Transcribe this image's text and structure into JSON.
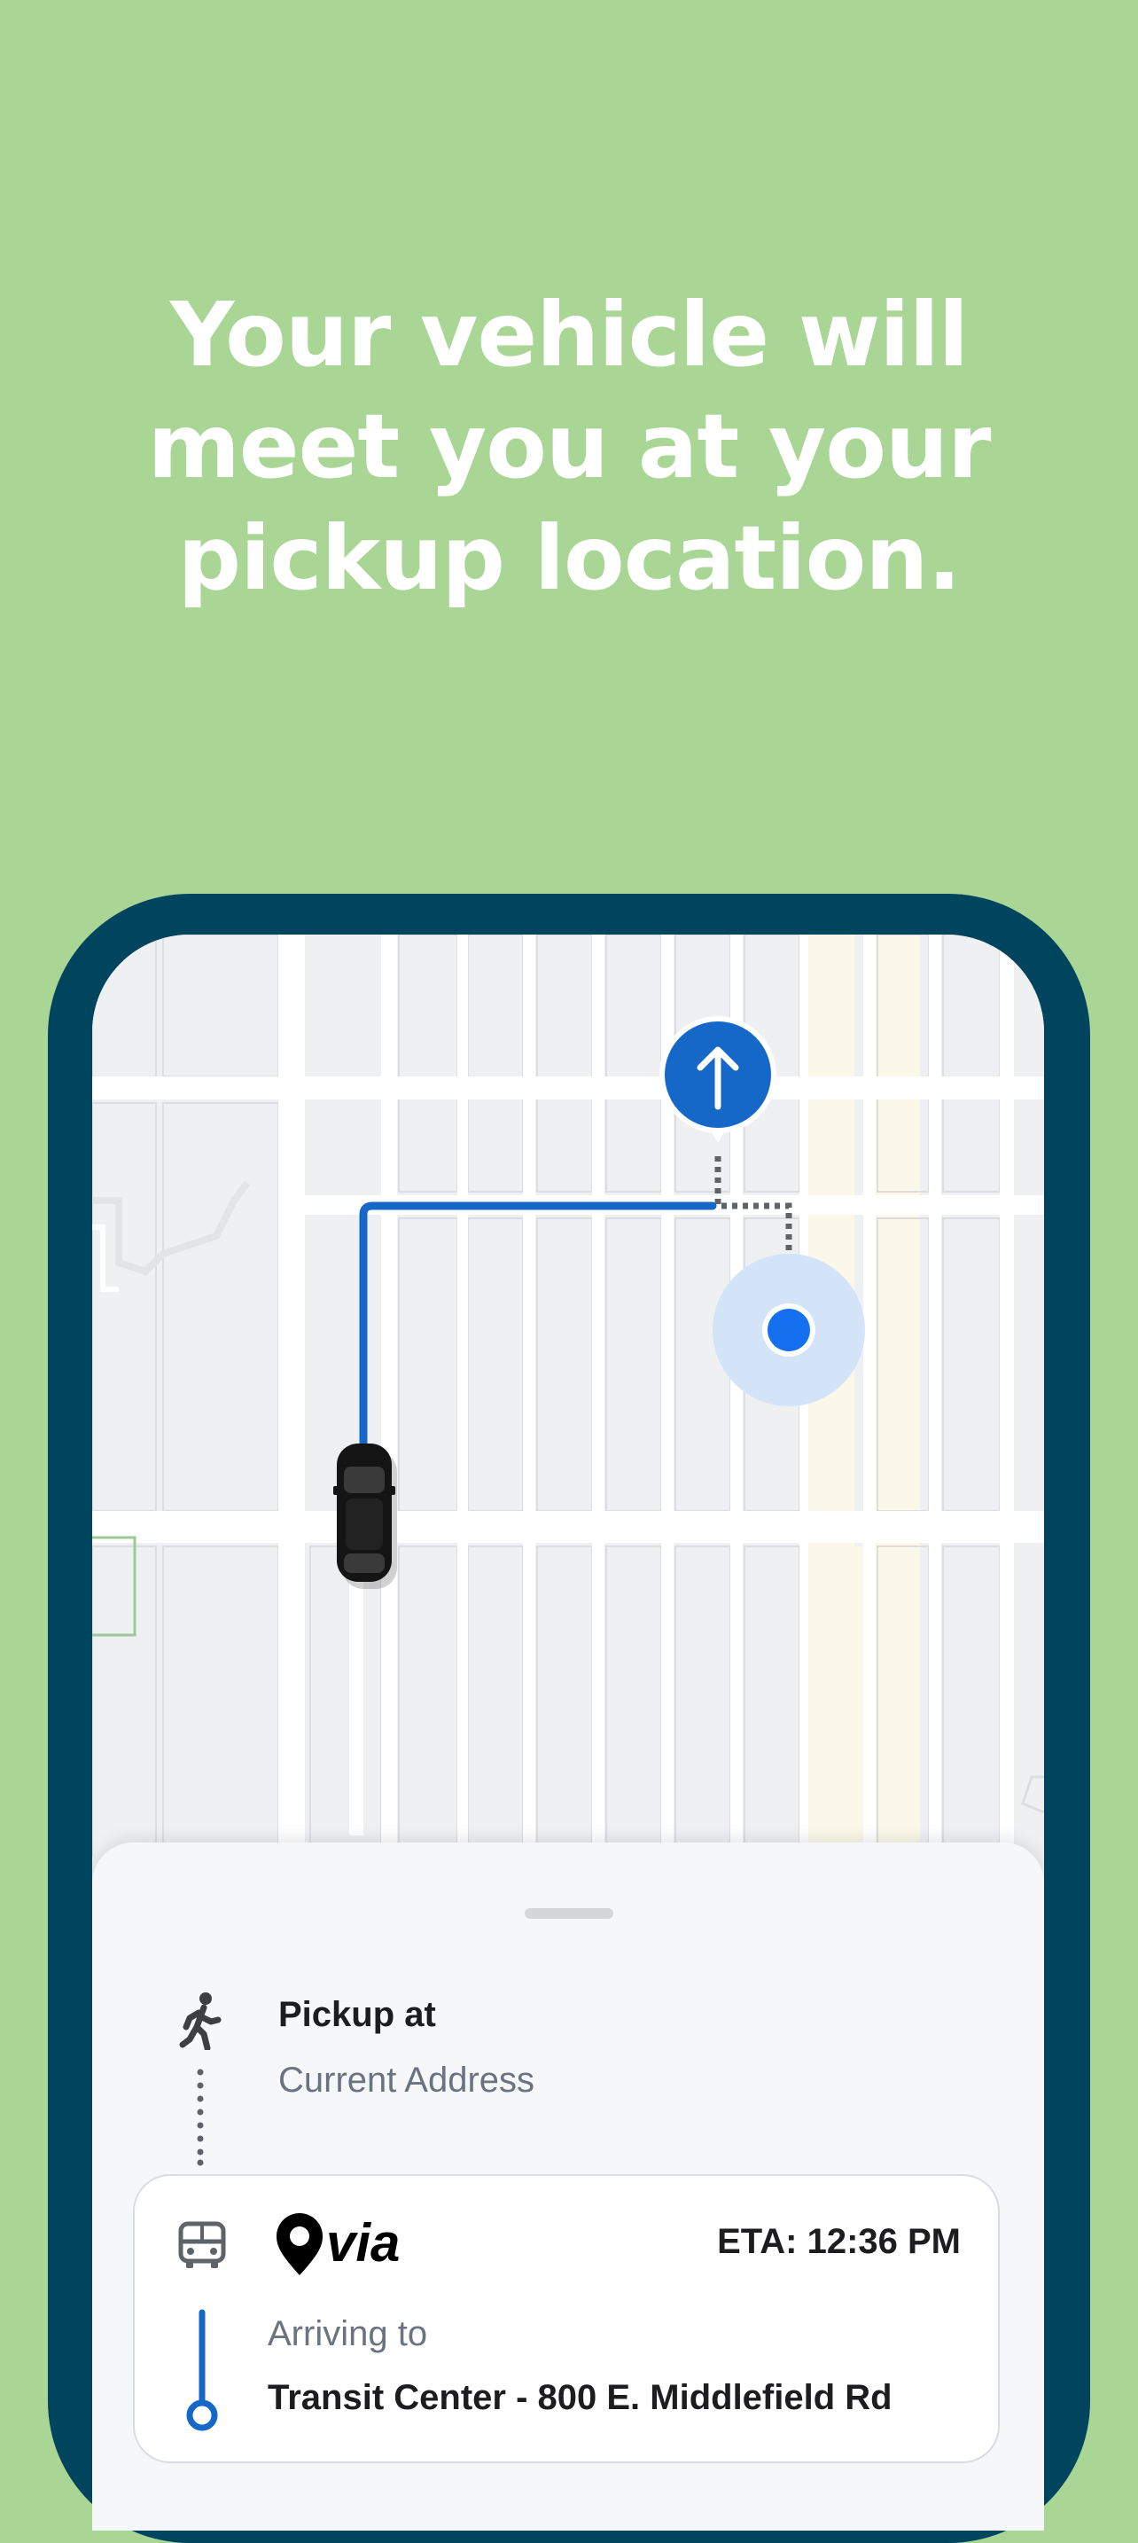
{
  "headline": {
    "line1": "Your vehicle will",
    "line2": "meet you at your",
    "line3": "pickup location."
  },
  "map": {
    "route_color": "#1567c8",
    "user_dot_color": "#1570ef",
    "pin_icon": "arrow-up-icon"
  },
  "pickup": {
    "title": "Pickup at",
    "address": "Current Address"
  },
  "ride": {
    "brand": "via",
    "eta": "ETA: 12:36 PM",
    "arriving_label": "Arriving to",
    "destination": "Transit Center - 800 E. Middlefield Rd"
  },
  "colors": {
    "background": "#a9d595",
    "phone_frame": "#00445e",
    "accent_blue": "#1567c8"
  }
}
